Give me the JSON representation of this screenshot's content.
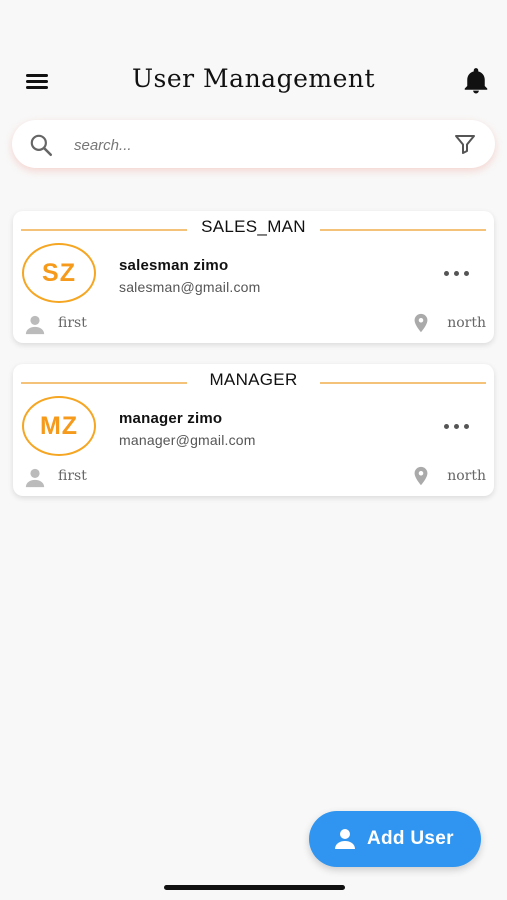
{
  "header": {
    "title": "User Management",
    "menu_icon": "hamburger-menu-icon",
    "notification_icon": "bell-icon"
  },
  "search": {
    "placeholder": "search...",
    "value": "",
    "search_icon": "search-icon",
    "filter_icon": "filter-icon"
  },
  "users": [
    {
      "role": "SALES_MAN",
      "initials": "SZ",
      "name": "salesman zimo",
      "email": "salesman@gmail.com",
      "level": "first",
      "region": "north"
    },
    {
      "role": "MANAGER",
      "initials": "MZ",
      "name": "manager zimo",
      "email": "manager@gmail.com",
      "level": "first",
      "region": "north"
    }
  ],
  "add_button": {
    "label": "Add User",
    "icon": "person-icon"
  },
  "colors": {
    "accent": "#2f95f0",
    "avatar_ring": "#f5a623",
    "role_line": "#f5c27a"
  }
}
